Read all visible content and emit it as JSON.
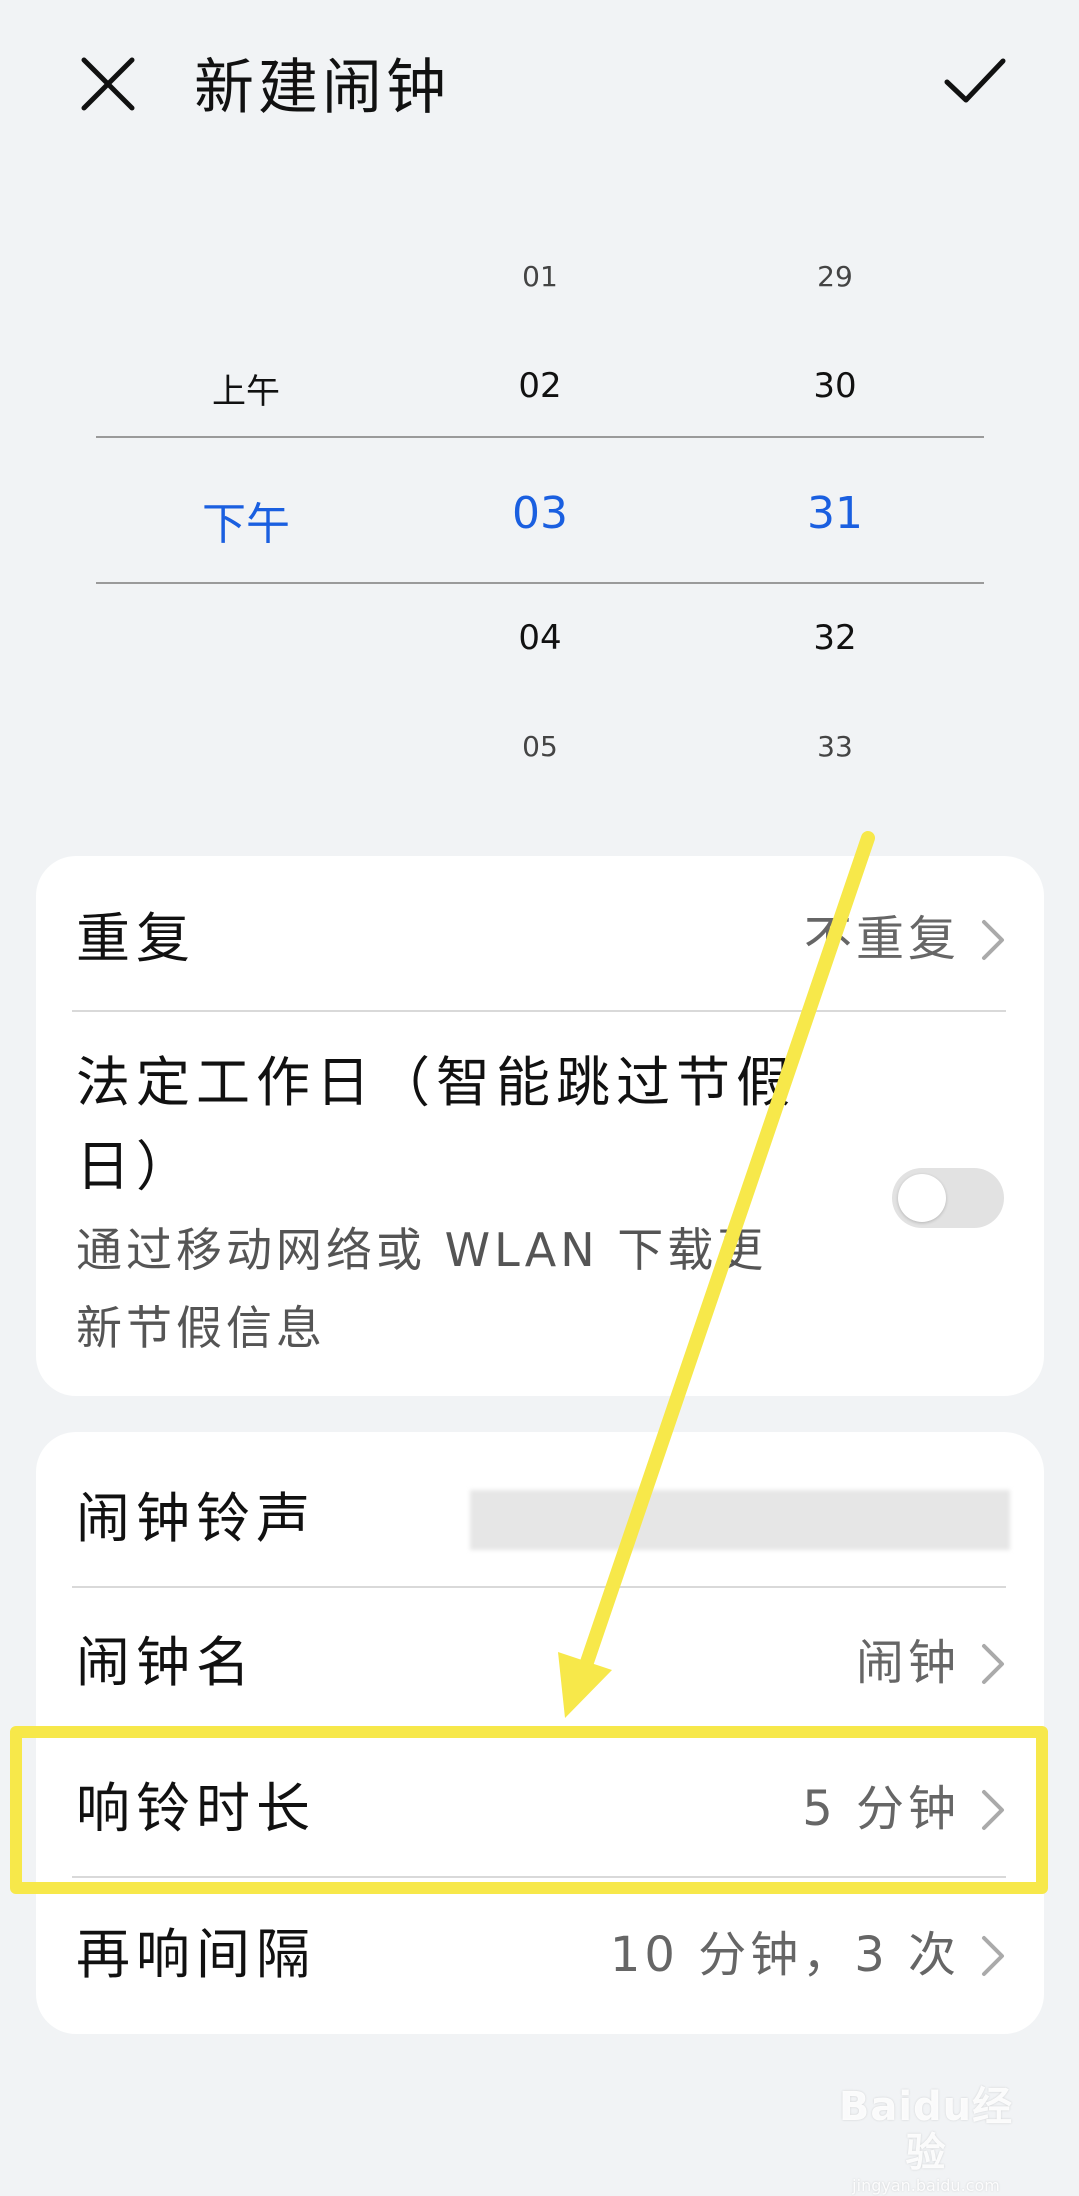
{
  "header": {
    "title": "新建闹钟"
  },
  "picker": {
    "ampm": {
      "above": "上午",
      "selected": "下午"
    },
    "hours": {
      "far_above": "01",
      "above": "02",
      "selected": "03",
      "below": "04",
      "far_below": "05"
    },
    "minutes": {
      "far_above": "29",
      "above": "30",
      "selected": "31",
      "below": "32",
      "far_below": "33"
    },
    "selected_color": "#1a5fe0"
  },
  "settings": {
    "repeat": {
      "label": "重复",
      "value": "不重复"
    },
    "workday": {
      "label_line1": "法定工作日（智能跳过节假",
      "label_line2": "日）",
      "desc_line1": "通过移动网络或 WLAN 下载更",
      "desc_line2": "新节假信息",
      "enabled": false
    },
    "ringtone": {
      "label": "闹钟铃声"
    },
    "name": {
      "label": "闹钟名",
      "value": "闹钟"
    },
    "ring_duration": {
      "label": "响铃时长",
      "value": "5 分钟"
    },
    "snooze": {
      "label": "再响间隔",
      "value": "10 分钟，3 次"
    }
  },
  "annotation": {
    "color": "#f7e84a"
  },
  "watermark": {
    "logo": "Baidu经验",
    "url": "jingyan.baidu.com"
  }
}
